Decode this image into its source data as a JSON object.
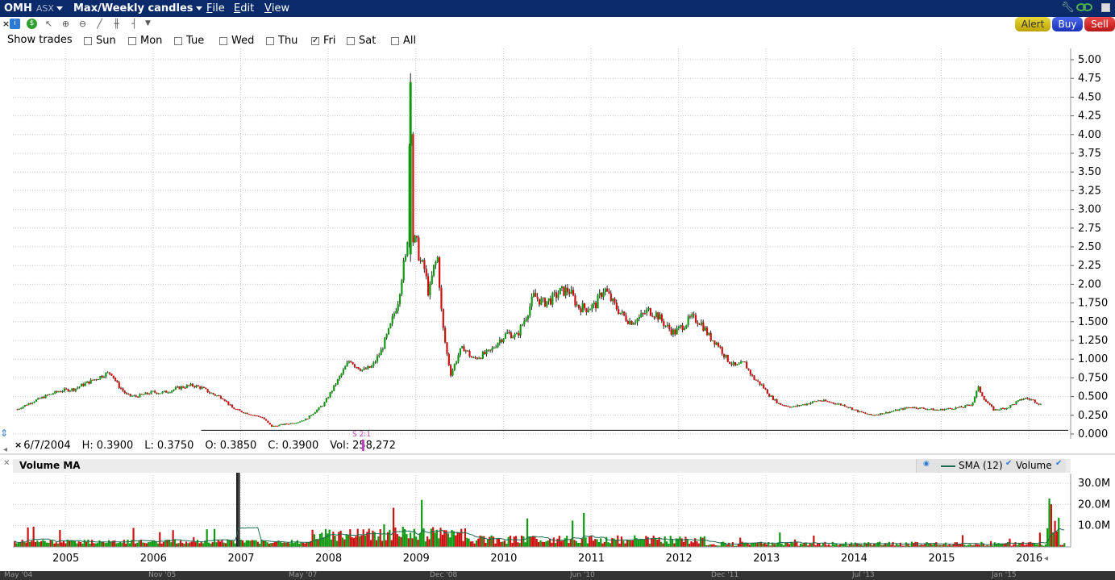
{
  "titlebar": {
    "symbol": "OMH",
    "exchange": "ASX",
    "chart_mode": "Max/Weekly candles",
    "menu_file_prefix": "F",
    "menu_file_rest": "ile",
    "menu_edit_prefix": "E",
    "menu_edit_rest": "dit",
    "menu_view_prefix": "V",
    "menu_view_rest": "iew"
  },
  "actions": {
    "alert": "Alert",
    "buy": "Buy",
    "sell": "Sell"
  },
  "show_trades": {
    "label": "Show trades",
    "days": [
      {
        "label": "Sun",
        "checked": false
      },
      {
        "label": "Mon",
        "checked": false
      },
      {
        "label": "Tue",
        "checked": false
      },
      {
        "label": "Wed",
        "checked": false
      },
      {
        "label": "Thu",
        "checked": false
      },
      {
        "label": "Fri",
        "checked": true
      },
      {
        "label": "Sat",
        "checked": false
      },
      {
        "label": "All",
        "checked": false
      }
    ]
  },
  "ohlc": {
    "date": "6/7/2004",
    "high_label": "H:",
    "high": "0.3900",
    "low_label": "L:",
    "low": "0.3750",
    "open_label": "O:",
    "open": "0.3850",
    "close_label": "C:",
    "close": "0.3900",
    "vol_label": "Vol:",
    "vol": "258,272"
  },
  "split_marker": "S 2:1",
  "volume_panel": {
    "title": "Volume MA",
    "legend_sma": "SMA (12)",
    "legend_volume": "Volume"
  },
  "navigator_labels": [
    "May '04",
    "Nov '05",
    "May '07",
    "Dec '08",
    "Jun '10",
    "Dec '11",
    "Jul '13",
    "Jan '15"
  ],
  "colors": {
    "up": "#119911",
    "down": "#cc1111",
    "titlebar": "#0a2a6a",
    "grid": "#c8c8c8",
    "sma": "#1f6b4f",
    "alert": "#d8c400",
    "buy": "#1d3ad8",
    "sell": "#d81d1d"
  },
  "chart_data": [
    {
      "type": "candlestick",
      "price_axis": {
        "ticks": [
          "5.00",
          "4.75",
          "4.50",
          "4.25",
          "4.00",
          "3.75",
          "3.50",
          "3.25",
          "3.00",
          "2.75",
          "2.50",
          "2.25",
          "2.00",
          "1.750",
          "1.500",
          "1.250",
          "1.000",
          "0.750",
          "0.500",
          "0.250",
          "0.000"
        ],
        "ylim": [
          0,
          5
        ]
      },
      "x_ticks": [
        "2005",
        "2006",
        "2007",
        "2008",
        "2009",
        "2010",
        "2011",
        "2012",
        "2013",
        "2014",
        "2015",
        "2016"
      ],
      "xlim": [
        2004.4,
        2016.45
      ],
      "series": [
        {
          "name": "OMH",
          "points": [
            [
              2004.45,
              0.33
            ],
            [
              2004.6,
              0.42
            ],
            [
              2004.8,
              0.52
            ],
            [
              2004.95,
              0.58
            ],
            [
              2005.1,
              0.6
            ],
            [
              2005.2,
              0.66
            ],
            [
              2005.35,
              0.74
            ],
            [
              2005.45,
              0.8
            ],
            [
              2005.52,
              0.82
            ],
            [
              2005.6,
              0.65
            ],
            [
              2005.7,
              0.52
            ],
            [
              2005.8,
              0.5
            ],
            [
              2005.9,
              0.53
            ],
            [
              2006.0,
              0.56
            ],
            [
              2006.1,
              0.55
            ],
            [
              2006.2,
              0.58
            ],
            [
              2006.3,
              0.62
            ],
            [
              2006.45,
              0.65
            ],
            [
              2006.55,
              0.62
            ],
            [
              2006.65,
              0.55
            ],
            [
              2006.8,
              0.48
            ],
            [
              2006.9,
              0.35
            ],
            [
              2007.0,
              0.3
            ],
            [
              2007.15,
              0.25
            ],
            [
              2007.25,
              0.22
            ],
            [
              2007.35,
              0.1
            ],
            [
              2007.45,
              0.12
            ],
            [
              2007.55,
              0.14
            ],
            [
              2007.65,
              0.16
            ],
            [
              2007.75,
              0.2
            ],
            [
              2007.85,
              0.3
            ],
            [
              2007.95,
              0.4
            ],
            [
              2008.05,
              0.6
            ],
            [
              2008.15,
              0.8
            ],
            [
              2008.25,
              1.0
            ],
            [
              2008.3,
              0.92
            ],
            [
              2008.4,
              0.85
            ],
            [
              2008.5,
              0.9
            ],
            [
              2008.6,
              1.1
            ],
            [
              2008.7,
              1.4
            ],
            [
              2008.8,
              1.8
            ],
            [
              2008.85,
              2.2
            ],
            [
              2008.9,
              2.4
            ],
            [
              2008.94,
              4.7
            ],
            [
              2008.97,
              2.5
            ],
            [
              2009.0,
              2.6
            ],
            [
              2009.05,
              2.3
            ],
            [
              2009.1,
              2.2
            ],
            [
              2009.15,
              1.85
            ],
            [
              2009.2,
              2.2
            ],
            [
              2009.25,
              2.35
            ],
            [
              2009.3,
              1.5
            ],
            [
              2009.35,
              1.1
            ],
            [
              2009.4,
              0.8
            ],
            [
              2009.45,
              0.95
            ],
            [
              2009.5,
              1.1
            ],
            [
              2009.55,
              1.15
            ],
            [
              2009.65,
              1.0
            ],
            [
              2009.75,
              1.05
            ],
            [
              2009.85,
              1.1
            ],
            [
              2009.95,
              1.25
            ],
            [
              2010.05,
              1.35
            ],
            [
              2010.15,
              1.3
            ],
            [
              2010.25,
              1.55
            ],
            [
              2010.35,
              1.85
            ],
            [
              2010.45,
              1.75
            ],
            [
              2010.55,
              1.8
            ],
            [
              2010.65,
              1.9
            ],
            [
              2010.75,
              1.92
            ],
            [
              2010.85,
              1.7
            ],
            [
              2010.95,
              1.68
            ],
            [
              2011.05,
              1.72
            ],
            [
              2011.15,
              1.95
            ],
            [
              2011.25,
              1.75
            ],
            [
              2011.35,
              1.6
            ],
            [
              2011.45,
              1.5
            ],
            [
              2011.55,
              1.55
            ],
            [
              2011.65,
              1.65
            ],
            [
              2011.75,
              1.6
            ],
            [
              2011.85,
              1.45
            ],
            [
              2011.95,
              1.35
            ],
            [
              2012.05,
              1.45
            ],
            [
              2012.15,
              1.55
            ],
            [
              2012.25,
              1.5
            ],
            [
              2012.35,
              1.3
            ],
            [
              2012.45,
              1.2
            ],
            [
              2012.55,
              1.0
            ],
            [
              2012.65,
              0.9
            ],
            [
              2012.75,
              0.95
            ],
            [
              2012.85,
              0.75
            ],
            [
              2012.95,
              0.65
            ],
            [
              2013.05,
              0.5
            ],
            [
              2013.15,
              0.4
            ],
            [
              2013.3,
              0.36
            ],
            [
              2013.45,
              0.4
            ],
            [
              2013.6,
              0.45
            ],
            [
              2013.75,
              0.42
            ],
            [
              2013.9,
              0.38
            ],
            [
              2014.05,
              0.3
            ],
            [
              2014.2,
              0.25
            ],
            [
              2014.35,
              0.28
            ],
            [
              2014.5,
              0.32
            ],
            [
              2014.65,
              0.36
            ],
            [
              2014.8,
              0.34
            ],
            [
              2014.95,
              0.32
            ],
            [
              2015.1,
              0.34
            ],
            [
              2015.25,
              0.36
            ],
            [
              2015.35,
              0.4
            ],
            [
              2015.42,
              0.62
            ],
            [
              2015.5,
              0.45
            ],
            [
              2015.6,
              0.32
            ],
            [
              2015.75,
              0.35
            ],
            [
              2015.85,
              0.42
            ],
            [
              2015.95,
              0.48
            ],
            [
              2016.05,
              0.45
            ],
            [
              2016.15,
              0.38
            ]
          ]
        }
      ],
      "level_line": 0.05
    },
    {
      "type": "bar",
      "title": "Volume MA",
      "volume_axis": {
        "ticks": [
          "30.0M",
          "20.0M",
          "10.0M"
        ],
        "ylim": [
          0,
          40000000
        ]
      },
      "overlay": "SMA (12)"
    }
  ]
}
